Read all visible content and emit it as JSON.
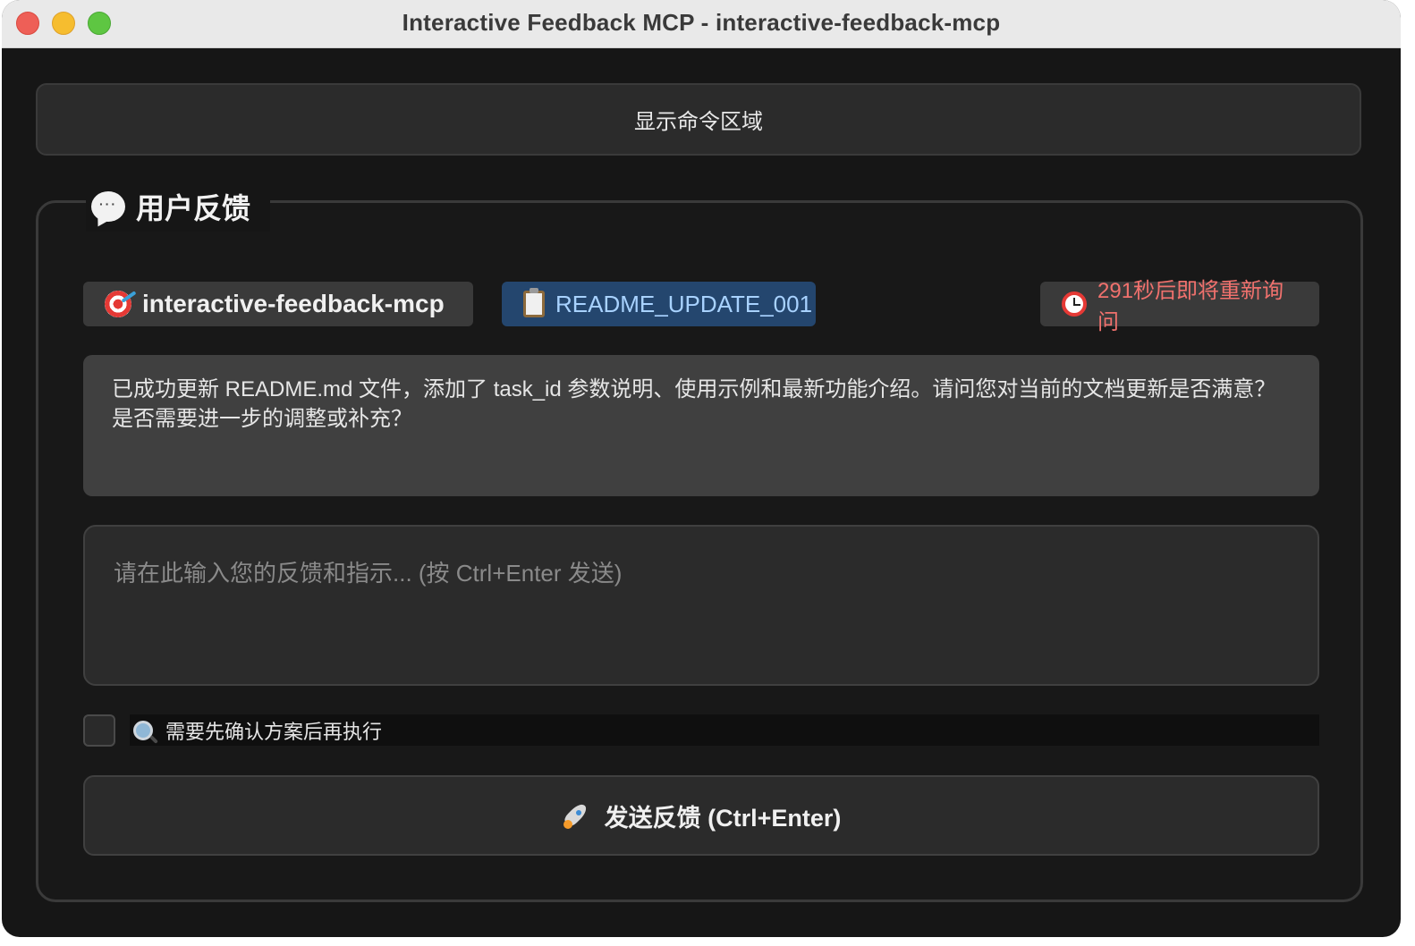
{
  "window": {
    "title": "Interactive Feedback MCP - interactive-feedback-mcp"
  },
  "command_toggle": {
    "label": "显示命令区域"
  },
  "feedback_group": {
    "title": "用户反馈",
    "project_chip": "interactive-feedback-mcp",
    "task_chip": "README_UPDATE_001",
    "timer_chip": "291秒后即将重新询问",
    "message": "已成功更新 README.md 文件，添加了 task_id 参数说明、使用示例和最新功能介绍。请问您对当前的文档更新是否满意？是否需要进一步的调整或补充？",
    "input": {
      "placeholder": "请在此输入您的反馈和指示... (按 Ctrl+Enter 发送)",
      "value": ""
    },
    "confirm_checkbox": {
      "label": "需要先确认方案后再执行",
      "checked": false
    },
    "send_button": {
      "label": "发送反馈 (Ctrl+Enter)"
    }
  },
  "icons": {
    "title_icon": "speech-bubble-icon",
    "project_icon": "target-icon",
    "task_icon": "clipboard-icon",
    "timer_icon": "alarm-clock-icon",
    "confirm_icon": "magnifier-icon",
    "send_icon": "rocket-icon"
  },
  "colors": {
    "background": "#161616",
    "task_chip_bg": "#24466e",
    "task_chip_text": "#a8d2ff",
    "timer_text": "#f0716d"
  }
}
